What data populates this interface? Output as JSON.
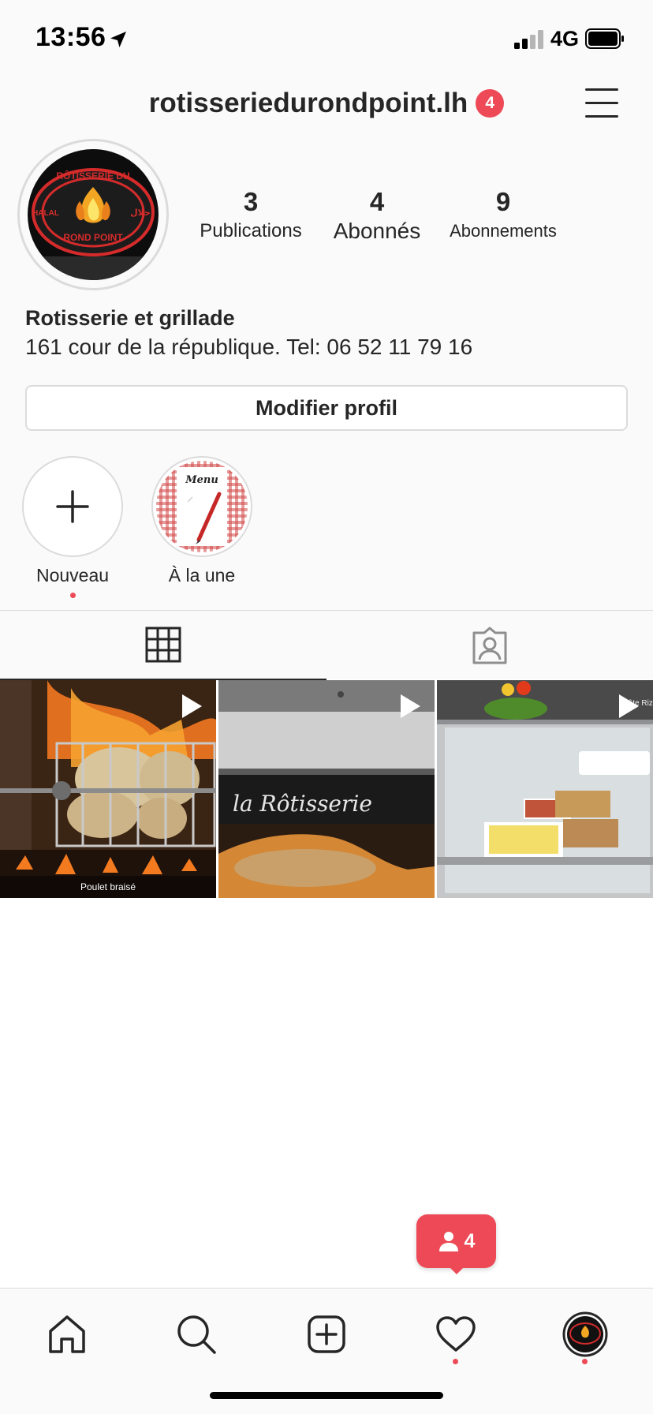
{
  "status_bar": {
    "time": "13:56",
    "network": "4G"
  },
  "header": {
    "username": "rotisseriedurondpoint.lh",
    "notification_count": "4"
  },
  "profile": {
    "avatar_text_top": "RÔTISSERIE DU",
    "avatar_text_bottom": "ROND POINT",
    "avatar_text_left": "HALAL",
    "avatar_text_right": "حلال",
    "stats": {
      "publications": {
        "value": "3",
        "label": "Publications"
      },
      "abonnes": {
        "value": "4",
        "label": "Abonnés"
      },
      "abonnements": {
        "value": "9",
        "label": "Abonnements"
      }
    },
    "bio_name": "Rotisserie et grillade",
    "bio_text": "161 cour de la république. Tel: 06 52 11 79 16",
    "edit_button": "Modifier profil"
  },
  "highlights": [
    {
      "label": "Nouveau"
    },
    {
      "label": "À la une",
      "cover_text": "Menu"
    }
  ],
  "posts": [
    {
      "caption": "Poulet braisé"
    },
    {
      "sign_text": "la Rôtisserie"
    },
    {
      "side_text": "Pâte Riz Bo"
    }
  ],
  "floating_badge": {
    "count": "4"
  },
  "colors": {
    "accent": "#ed4956",
    "text": "#262626",
    "border": "#dbdbdb"
  },
  "icons": [
    "location-arrow-icon",
    "signal-icon",
    "battery-icon",
    "menu-icon",
    "plus-icon",
    "grid-icon",
    "tagged-icon",
    "play-icon",
    "person-icon",
    "home-icon",
    "search-icon",
    "new-post-icon",
    "heart-icon"
  ]
}
